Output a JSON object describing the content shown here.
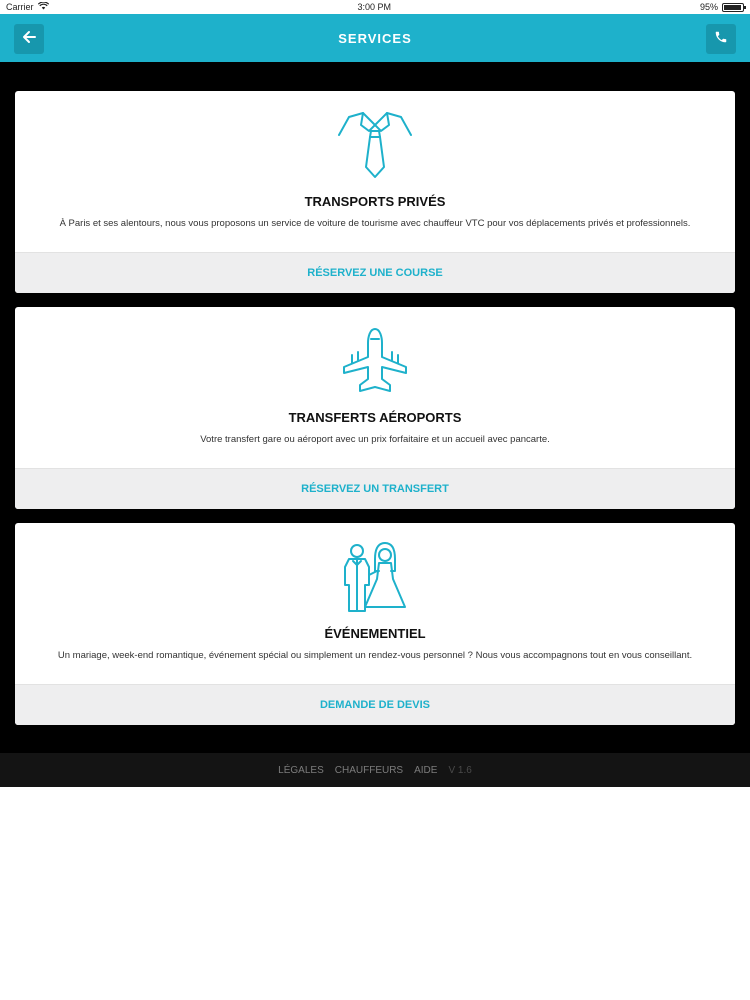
{
  "status_bar": {
    "carrier": "Carrier",
    "time": "3:00 PM",
    "battery": "95%",
    "battery_level": 0.95
  },
  "header": {
    "title": "SERVICES",
    "back_icon": "arrow-left-icon",
    "call_icon": "phone-icon",
    "accent_color": "#1eb1cb"
  },
  "services": [
    {
      "icon": "tie-collar-icon",
      "title": "TRANSPORTS PRIVÉS",
      "description": "À Paris et ses alentours, nous vous proposons un service de voiture de tourisme avec chauffeur VTC pour vos déplacements privés et professionnels.",
      "action": "RÉSERVEZ UNE COURSE"
    },
    {
      "icon": "airplane-icon",
      "title": "TRANSFERTS AÉROPORTS",
      "description": "Votre transfert gare ou aéroport avec un prix forfaitaire et un accueil avec pancarte.",
      "action": "RÉSERVEZ UN TRANSFERT"
    },
    {
      "icon": "wedding-couple-icon",
      "title": "ÉVÉNEMENTIEL",
      "description": "Un mariage, week-end romantique, événement spécial ou simplement un rendez-vous personnel ? Nous vous accompagnons tout en vous conseillant.",
      "action": "DEMANDE DE DEVIS"
    }
  ],
  "footer": {
    "links": [
      "LÉGALES",
      "CHAUFFEURS",
      "AIDE"
    ],
    "version": "V 1.6"
  }
}
